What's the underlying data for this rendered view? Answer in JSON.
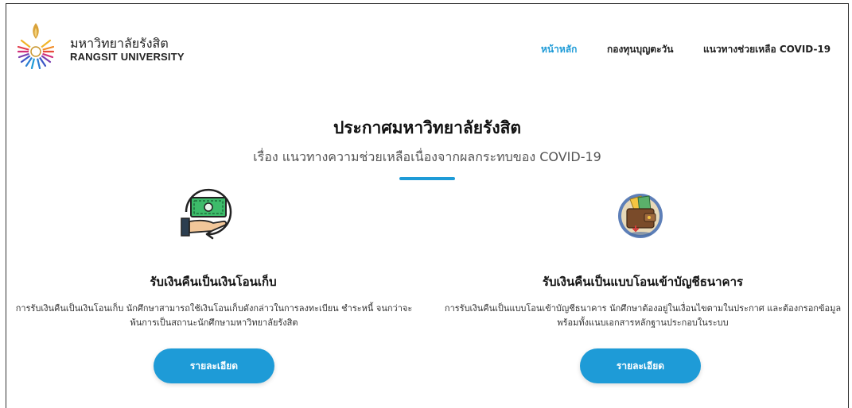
{
  "header": {
    "brand_thai": "มหาวิทยาลัยรังสิต",
    "brand_english": "RANGSIT UNIVERSITY"
  },
  "nav": {
    "items": [
      {
        "label": "หน้าหลัก",
        "active": true
      },
      {
        "label": "กองทุนบุญตะวัน",
        "active": false
      },
      {
        "label": "แนวทางช่วยเหลือ COVID-19",
        "active": false
      }
    ]
  },
  "main": {
    "title": "ประกาศมหาวิทยาลัยรังสิต",
    "subtitle": "เรื่อง แนวทางความช่วยเหลือเนื่องจากผลกระทบของ COVID-19"
  },
  "cards": [
    {
      "icon": "cash-refund-hand-icon",
      "title": "รับเงินคืนเป็นเงินโอนเก็บ",
      "description": "การรับเงินคืนเป็นเงินโอนเก็บ นักศึกษาสามารถใช้เงินโอนเก็บดังกล่าวในการลงทะเบียน ชำระหนี้ จนกว่าจะพ้นการเป็นสถานะนักศึกษามหาวิทยาลัยรังสิต",
      "button_label": "รายละเอียด"
    },
    {
      "icon": "wallet-bank-transfer-icon",
      "title": "รับเงินคืนเป็นแบบโอนเข้าบัญชีธนาคาร",
      "description": "การรับเงินคืนเป็นแบบโอนเข้าบัญชีธนาคาร นักศึกษาต้องอยู่ในเงื่อนไขตามในประกาศ และต้องกรอกข้อมูลพร้อมทั้งแนบเอกสารหลักฐานประกอบในระบบ",
      "button_label": "รายละเอียด"
    }
  ],
  "colors": {
    "accent": "#1e9bd7",
    "text": "#111111",
    "muted": "#555555"
  }
}
